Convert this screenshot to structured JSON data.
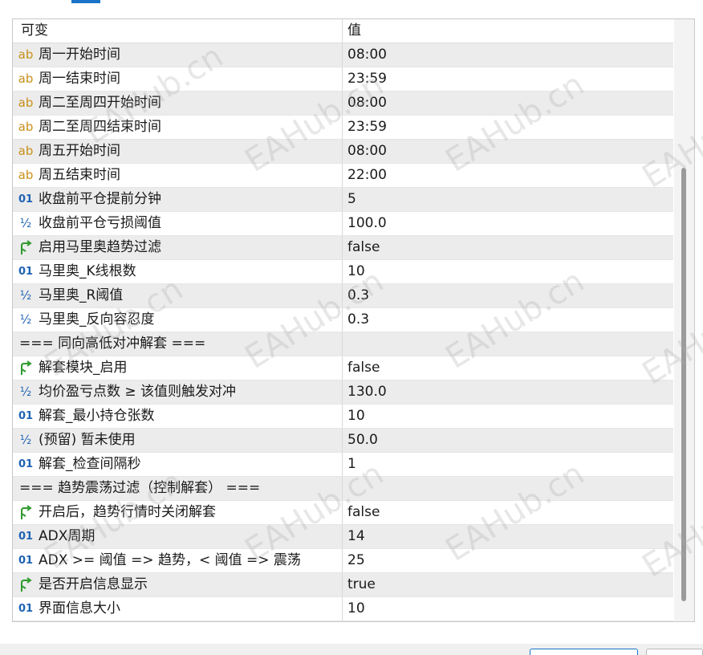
{
  "header": {
    "name": "可变",
    "value": "值"
  },
  "rows": [
    {
      "type": "ab",
      "name": "周一开始时间",
      "value": "08:00",
      "shaded": true
    },
    {
      "type": "ab",
      "name": "周一结束时间",
      "value": "23:59",
      "shaded": false
    },
    {
      "type": "ab",
      "name": "周二至周四开始时间",
      "value": "08:00",
      "shaded": true
    },
    {
      "type": "ab",
      "name": "周二至周四结束时间",
      "value": "23:59",
      "shaded": false
    },
    {
      "type": "ab",
      "name": "周五开始时间",
      "value": "08:00",
      "shaded": true
    },
    {
      "type": "ab",
      "name": "周五结束时间",
      "value": "22:00",
      "shaded": false
    },
    {
      "type": "int",
      "name": "收盘前平仓提前分钟",
      "value": "5",
      "shaded": true
    },
    {
      "type": "dbl",
      "name": "收盘前平仓亏损阈值",
      "value": "100.0",
      "shaded": false
    },
    {
      "type": "bool",
      "name": "启用马里奥趋势过滤",
      "value": "false",
      "shaded": true
    },
    {
      "type": "int",
      "name": "马里奥_K线根数",
      "value": "10",
      "shaded": false
    },
    {
      "type": "dbl",
      "name": "马里奥_R阈值",
      "value": "0.3",
      "shaded": true
    },
    {
      "type": "dbl",
      "name": "马里奥_反向容忍度",
      "value": "0.3",
      "shaded": false
    },
    {
      "type": "section",
      "name": "=== 同向高低对冲解套 ===",
      "value": "",
      "shaded": true
    },
    {
      "type": "bool",
      "name": "解套模块_启用",
      "value": "false",
      "shaded": false
    },
    {
      "type": "dbl",
      "name": "均价盈亏点数 ≥ 该值则触发对冲",
      "value": "130.0",
      "shaded": true
    },
    {
      "type": "int",
      "name": "解套_最小持仓张数",
      "value": "10",
      "shaded": false
    },
    {
      "type": "dbl",
      "name": "(预留) 暂未使用",
      "value": "50.0",
      "shaded": true
    },
    {
      "type": "int",
      "name": "解套_检查间隔秒",
      "value": "1",
      "shaded": false
    },
    {
      "type": "section",
      "name": "=== 趋势震荡过滤（控制解套） ===",
      "value": "",
      "shaded": true
    },
    {
      "type": "bool",
      "name": "开启后，趋势行情时关闭解套",
      "value": "false",
      "shaded": false
    },
    {
      "type": "int",
      "name": "ADX周期",
      "value": "14",
      "shaded": true
    },
    {
      "type": "int",
      "name": "ADX >= 阈值 => 趋势，< 阈值 => 震荡",
      "value": "25",
      "shaded": false
    },
    {
      "type": "bool",
      "name": "是否开启信息显示",
      "value": "true",
      "shaded": true
    },
    {
      "type": "int",
      "name": "界面信息大小",
      "value": "10",
      "shaded": false
    }
  ],
  "icons": {
    "ab": "string-type-icon",
    "int": "integer-type-icon",
    "dbl": "double-type-icon",
    "bool": "boolean-type-icon"
  },
  "icon_glyphs": {
    "ab": "ab",
    "int": "01",
    "dbl": "½"
  },
  "watermark": "EAHub.cn",
  "colors": {
    "string_icon": "#c8901c",
    "number_icon": "#1e63b4",
    "bool_icon": "#2e9a2e",
    "tab_indicator": "#1a73c8",
    "row_shaded": "#ececec"
  }
}
